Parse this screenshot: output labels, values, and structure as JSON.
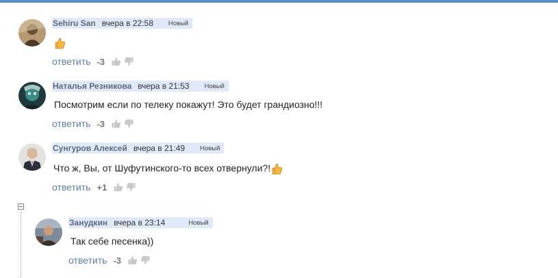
{
  "comments": [
    {
      "author": "Sehiru San",
      "time": "вчера в 22:58",
      "badge": "Новый",
      "text": "",
      "emoji": "thumbs-up",
      "reply_label": "ответить",
      "rating": "-3"
    },
    {
      "author": "Наталья Резникова",
      "time": "вчера в 21:53",
      "badge": "Новый",
      "text": "Посмотрим если по телеку покажут! Это будет грандиозно!!!",
      "reply_label": "ответить",
      "rating": "-3"
    },
    {
      "author": "Сунгуров Алексей",
      "time": "вчера в 21:49",
      "badge": "Новый",
      "text": "Что ж, Вы, от Шуфутинского-то всех отвернули?!",
      "emoji": "thumbs-up",
      "reply_label": "ответить",
      "rating": "+1"
    },
    {
      "author": "Занудкин",
      "time": "вчера в 23:14",
      "badge": "Новый",
      "text": "Так себе песенка))",
      "reply_label": "ответить",
      "rating": "-3"
    }
  ],
  "colors": {
    "header_bg": "#dfe9f7",
    "author": "#5d6b7f",
    "reply_link": "#5c7fa8",
    "topbar": "#5b8fc0"
  }
}
